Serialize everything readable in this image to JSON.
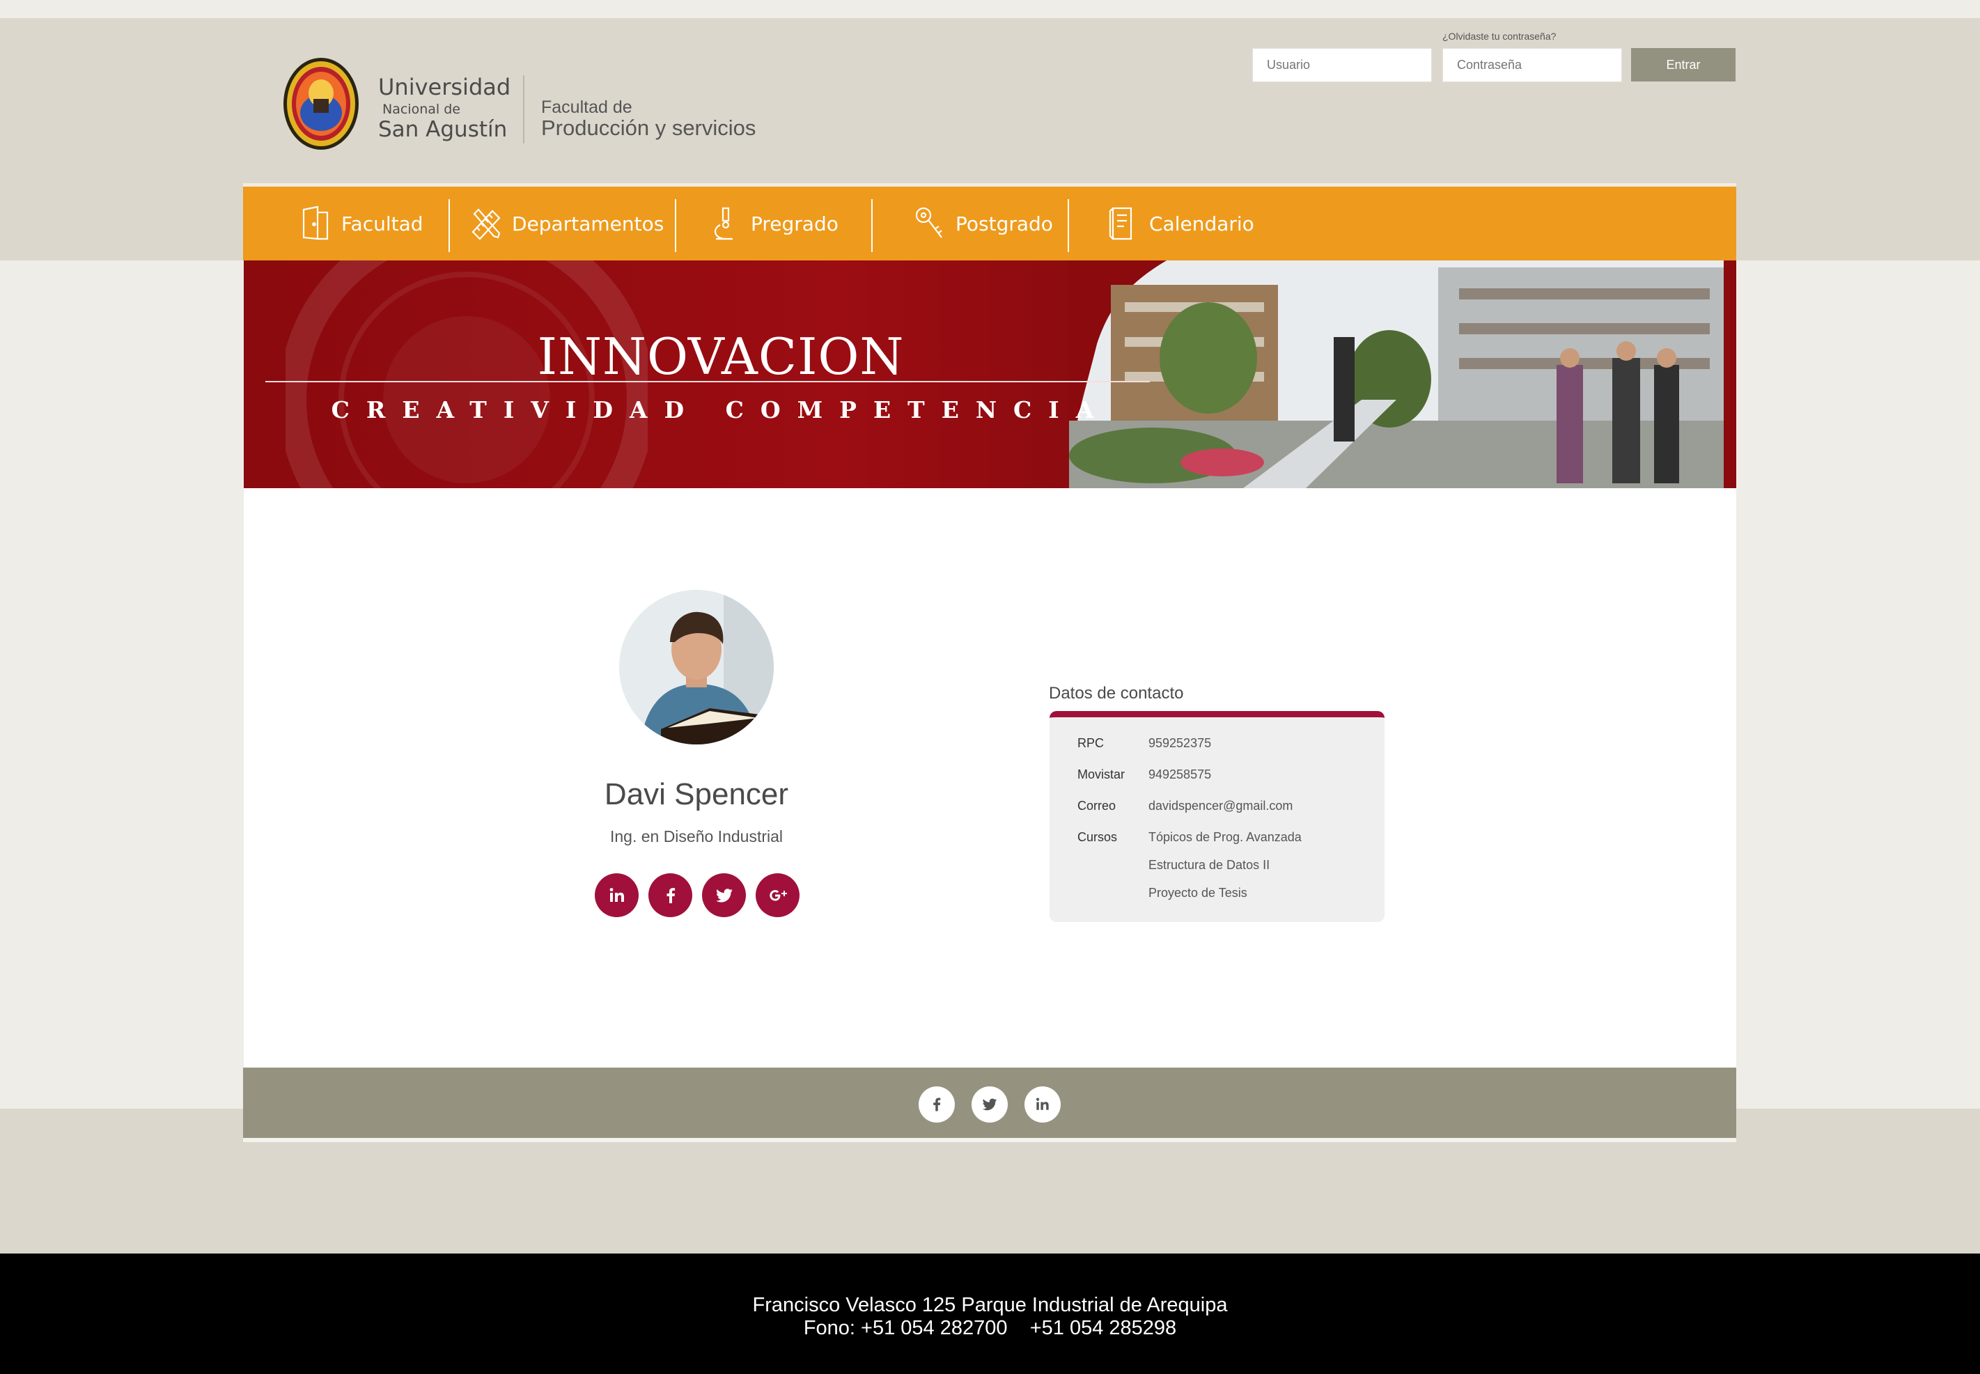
{
  "header": {
    "university_line1": "Universidad",
    "university_line2": "Nacional de",
    "university_line3": "San Agustín",
    "faculty_line1": "Facultad de",
    "faculty_line2": "Producción y servicios"
  },
  "login": {
    "forgot_password": "¿Olvidaste tu contraseña?",
    "user_placeholder": "Usuario",
    "password_placeholder": "Contraseña",
    "submit_label": "Entrar"
  },
  "nav": {
    "items": [
      {
        "label": "Facultad",
        "icon": "door-icon"
      },
      {
        "label": "Departamentos",
        "icon": "ruler-pencil-icon"
      },
      {
        "label": "Pregrado",
        "icon": "microscope-icon"
      },
      {
        "label": "Postgrado",
        "icon": "key-icon"
      },
      {
        "label": "Calendario",
        "icon": "calendar-book-icon"
      }
    ],
    "color": "#ee9a1c"
  },
  "banner": {
    "title": "INNOVACION",
    "subtitle": "CREATIVIDAD COMPETENCIA"
  },
  "profile": {
    "name": "Davi Spencer",
    "title": "Ing. en Diseño Industrial",
    "social": [
      "linkedin-icon",
      "facebook-icon",
      "twitter-icon",
      "google-plus-icon"
    ],
    "accent_color": "#a0103b"
  },
  "contact": {
    "heading": "Datos de contacto",
    "rpc_label": "RPC",
    "rpc_value": "959252375",
    "movistar_label": "Movistar",
    "movistar_value": "949258575",
    "email_label": "Correo",
    "email_value": "davidspencer@gmail.com",
    "courses_label": "Cursos",
    "courses": [
      "Tópicos de Prog. Avanzada",
      "Estructura de Datos II",
      "Proyecto de Tesis"
    ]
  },
  "footer": {
    "social": [
      "facebook-icon",
      "twitter-icon",
      "linkedin-icon"
    ],
    "address": "Francisco Velasco 125 Parque Industrial de Arequipa",
    "phones": "Fono: +51 054 282700    +51 054 285298"
  }
}
